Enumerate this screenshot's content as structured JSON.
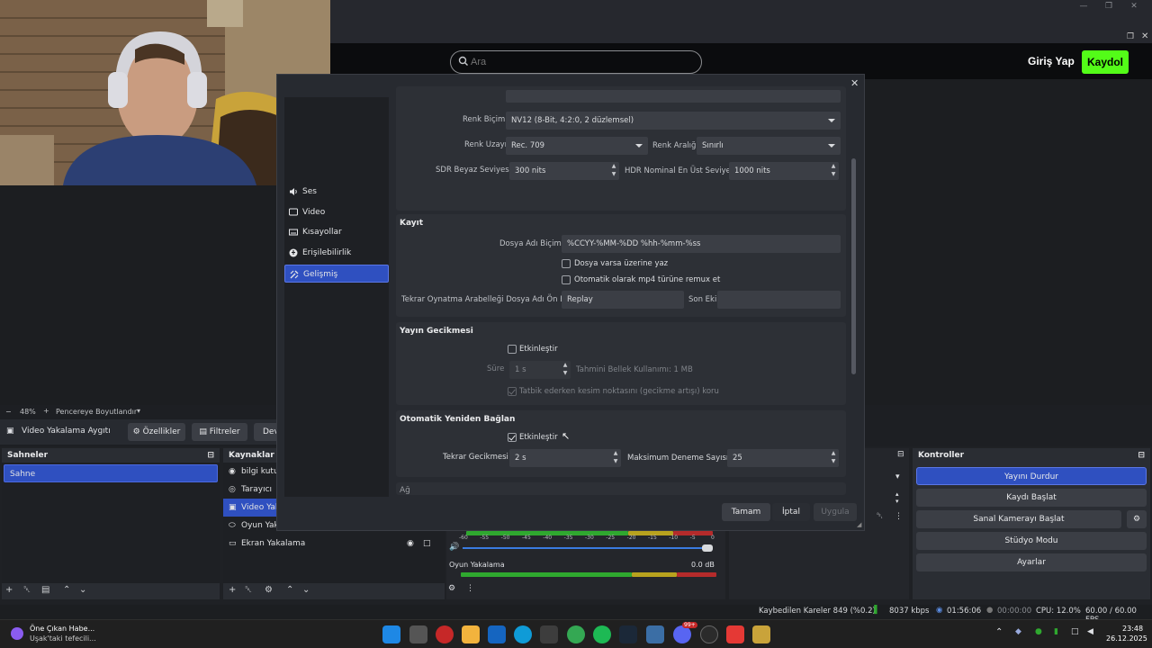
{
  "browser": {
    "search_placeholder": "Ara",
    "login_label": "Giriş Yap",
    "register_label": "Kaydol"
  },
  "preview": {
    "partial_text": "m",
    "zoom_label": "48%",
    "resize_label": "Pencereye Boyutlandır"
  },
  "source_toolbar": {
    "selected_source": "Video Yakalama Aygıtı",
    "properties_label": "Özellikler",
    "filters_label": "Filtreler",
    "truncated_label": "Dev"
  },
  "scenes": {
    "title": "Sahneler",
    "items": [
      "Sahne"
    ]
  },
  "sources": {
    "title": "Kaynaklar",
    "items": [
      "bilgi kutu",
      "Tarayıcı",
      "Video Yak",
      "Oyun Yaka",
      "Ekran Yakalama"
    ]
  },
  "mixer": {
    "scale": [
      "-60",
      "-55",
      "-50",
      "-45",
      "-40",
      "-35",
      "-30",
      "-25",
      "-20",
      "-15",
      "-10",
      "-5",
      "0"
    ],
    "channel_name": "Oyun Yakalama",
    "channel_db": "0.0 dB"
  },
  "controls": {
    "title": "Kontroller",
    "buttons": [
      "Yayını Durdur",
      "Kaydı Başlat",
      "Sanal Kamerayı Başlat",
      "Stüdyo Modu",
      "Ayarlar"
    ]
  },
  "status": {
    "dropped": "Kaybedilen Kareler 849 (%0.2)",
    "bitrate": "8037 kbps",
    "stream_time": "01:56:06",
    "rec_time": "00:00:00",
    "cpu": "CPU: 12.0%",
    "fps": "60.00 / 60.00 FPS"
  },
  "settings_dialog": {
    "sidebar": [
      "Ses",
      "Video",
      "Kısayollar",
      "Erişilebilirlik",
      "Gelişmiş"
    ],
    "video": {
      "color_format_label": "Renk Biçimi",
      "color_format_value": "NV12 (8-Bit, 4:2:0, 2 düzlemsel)",
      "color_space_label": "Renk Uzayı",
      "color_space_value": "Rec. 709",
      "color_range_label": "Renk Aralığı",
      "color_range_value": "Sınırlı",
      "sdr_label": "SDR Beyaz Seviyesi",
      "sdr_value": "300 nits",
      "hdr_label": "HDR Nominal En Üst Seviye",
      "hdr_value": "1000 nits"
    },
    "recording": {
      "title": "Kayıt",
      "filename_label": "Dosya Adı Biçimi",
      "filename_value": "%CCYY-%MM-%DD %hh-%mm-%ss",
      "overwrite_label": "Dosya varsa üzerine yaz",
      "remux_label": "Otomatik olarak mp4 türüne remux et",
      "replay_prefix_label": "Tekrar Oynatma Arabelleği Dosya Adı Ön Eki",
      "replay_prefix_value": "Replay",
      "suffix_label": "Son Eki",
      "suffix_value": ""
    },
    "stream_delay": {
      "title": "Yayın Gecikmesi",
      "enable_label": "Etkinleştir",
      "duration_label": "Süre",
      "duration_value": "1 s",
      "memory_label": "Tahmini Bellek Kullanımı: 1 MB",
      "preserve_label": "Tatbik ederken kesim noktasını (gecikme artışı) koru"
    },
    "reconnect": {
      "title": "Otomatik Yeniden Bağlan",
      "enable_label": "Etkinleştir",
      "retry_delay_label": "Tekrar Gecikmesi",
      "retry_delay_value": "2 s",
      "max_retries_label": "Maksimum Deneme Sayısı",
      "max_retries_value": "25"
    },
    "network_partial": "Ağ",
    "buttons": {
      "ok": "Tamam",
      "cancel": "İptal",
      "apply": "Uygula"
    }
  },
  "taskbar": {
    "news_title": "Öne Çıkan Habe...",
    "news_sub": "Uşak'taki tefecili...",
    "time": "23:48",
    "date": "26.12.2025",
    "badge": "99+"
  },
  "colors": {
    "accent": "#2f50c0",
    "kick_green": "#53fc18",
    "meter_green": "#2fa82f",
    "meter_yellow": "#b8a21e",
    "meter_red": "#b52b2b"
  }
}
